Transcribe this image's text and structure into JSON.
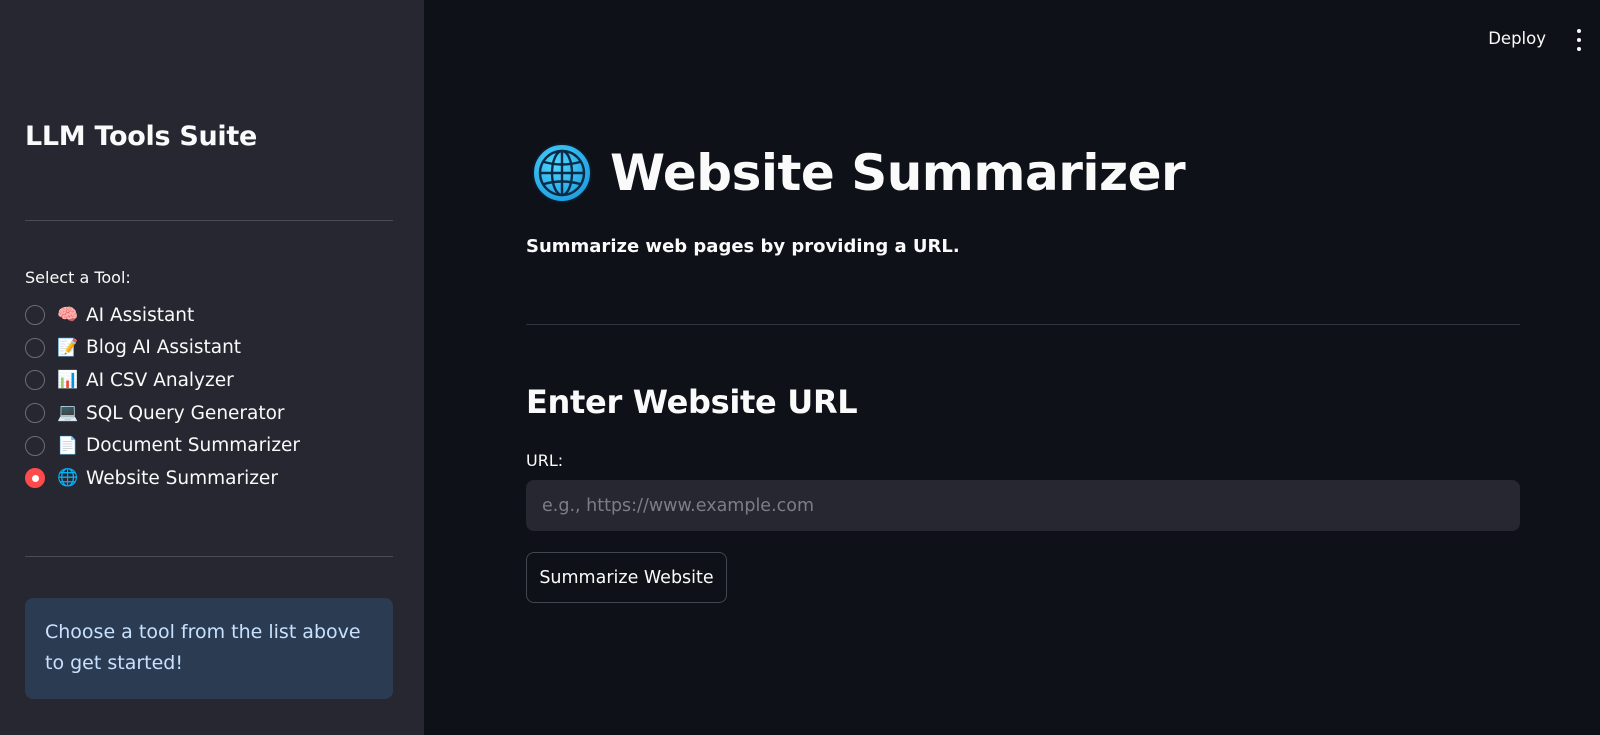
{
  "sidebar": {
    "title": "LLM Tools Suite",
    "select_label": "Select a Tool:",
    "tools": [
      {
        "emoji": "🧠",
        "label": "AI Assistant",
        "selected": false
      },
      {
        "emoji": "📝",
        "label": "Blog AI Assistant",
        "selected": false
      },
      {
        "emoji": "📊",
        "label": "AI CSV Analyzer",
        "selected": false
      },
      {
        "emoji": "💻",
        "label": "SQL Query Generator",
        "selected": false
      },
      {
        "emoji": "📄",
        "label": "Document Summarizer",
        "selected": false
      },
      {
        "emoji": "🌐",
        "label": "Website Summarizer",
        "selected": true
      }
    ],
    "info": "Choose a tool from the list above to get started!"
  },
  "header": {
    "deploy_label": "Deploy"
  },
  "main": {
    "title": "Website Summarizer",
    "title_icon": "globe-icon",
    "subtitle": "Summarize web pages by providing a URL.",
    "section_title": "Enter Website URL",
    "url_label": "URL:",
    "url_value": "",
    "url_placeholder": "e.g., https://www.example.com",
    "button_label": "Summarize Website"
  },
  "colors": {
    "background": "#0e1117",
    "sidebar": "#262730",
    "accent": "#ff4b4b",
    "info_bg": "#2b3b52"
  }
}
